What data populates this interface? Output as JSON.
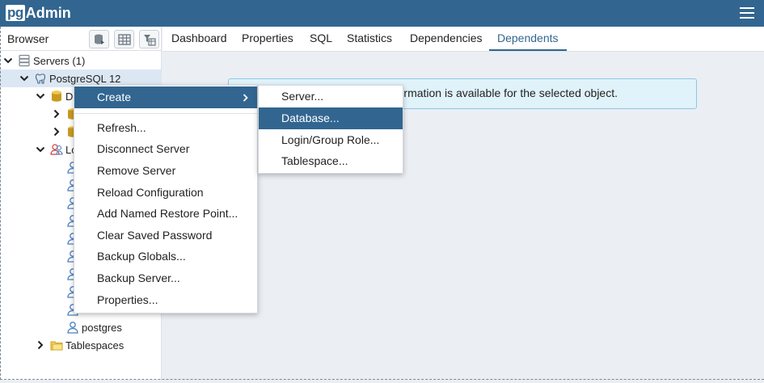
{
  "app": {
    "logo_pg": "pg",
    "logo_admin": "Admin"
  },
  "browser": {
    "title": "Browser",
    "tree": [
      {
        "label": "Servers (1)",
        "icon": "servers-icon"
      },
      {
        "label": "PostgreSQL 12",
        "icon": "postgresql-elephant-icon"
      },
      {
        "label": "D",
        "icon": "databases-icon"
      },
      {
        "label": "",
        "icon": "database-icon"
      },
      {
        "label": "",
        "icon": "database-icon"
      },
      {
        "label": "Lo",
        "icon": "login-roles-icon"
      },
      {
        "label": "postgres",
        "icon": "role-icon"
      },
      {
        "label": "Tablespaces",
        "icon": "tablespaces-folder-icon"
      }
    ]
  },
  "tabs": [
    "Dashboard",
    "Properties",
    "SQL",
    "Statistics",
    "Dependencies",
    "Dependents"
  ],
  "active_tab": "Dependents",
  "info_message": "rmation is available for the selected object.",
  "context_menu": {
    "items": [
      "Create",
      "Refresh...",
      "Disconnect Server",
      "Remove Server",
      "Reload Configuration",
      "Add Named Restore Point...",
      "Clear Saved Password",
      "Backup Globals...",
      "Backup Server...",
      "Properties..."
    ]
  },
  "submenu": {
    "items": [
      "Server...",
      "Database...",
      "Login/Group Role...",
      "Tablespace..."
    ]
  },
  "colors": {
    "brand": "#326690",
    "highlight": "#326690",
    "info_bg": "#e0f2fa"
  }
}
